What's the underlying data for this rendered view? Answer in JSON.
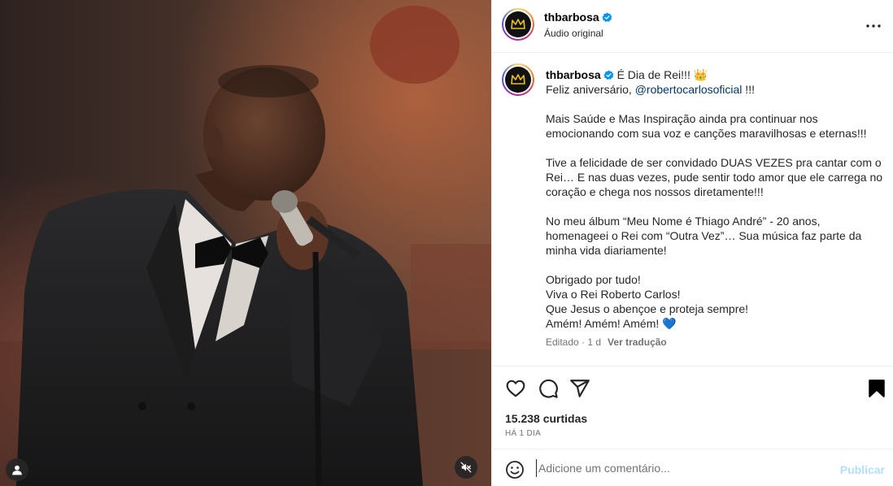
{
  "media": {
    "tag_icon": "user-tag-icon",
    "mute_icon": "muted-speaker-icon"
  },
  "header": {
    "username": "thbarbosa",
    "audio": "Áudio original",
    "more_icon": "more-horizontal-icon"
  },
  "caption": {
    "username": "thbarbosa",
    "title": "É Dia de Rei!!! 👑",
    "line2_prefix": "Feliz aniversário, ",
    "mention": "@robertocarlosoficial",
    "line2_suffix": " !!!",
    "paragraphs": [
      "Mais Saúde e Mas Inspiração ainda pra continuar nos\nemocionando com sua voz e canções maravilhosas e eternas!!!",
      "Tive a felicidade de ser convidado DUAS VEZES pra cantar com o\nRei… E nas duas vezes, pude sentir todo amor que ele carrega no\ncoração e chega nos nossos diretamente!!!",
      "No meu álbum “Meu Nome é Thiago André” - 20 anos,\nhomenageei o Rei com “Outra Vez”… Sua música faz parte da\nminha vida diariamente!",
      "Obrigado por tudo!\nViva o Rei Roberto Carlos!\nQue Jesus o abençoe e proteja sempre!\nAmém! Amém! Amém! 💙"
    ],
    "edited": "Editado · 1 d",
    "translate": "Ver tradução"
  },
  "actions": {
    "like_icon": "heart-icon",
    "comment_icon": "comment-icon",
    "share_icon": "share-icon",
    "save_icon": "bookmark-icon",
    "likes": "15.238 curtidas",
    "time_ago": "HÁ 1 DIA"
  },
  "comment": {
    "emoji_icon": "emoji-icon",
    "placeholder": "Adicione um comentário...",
    "publish": "Publicar"
  },
  "colors": {
    "verified": "#0095f6",
    "publish_disabled": "#b2dffc",
    "mention": "#00376b"
  }
}
